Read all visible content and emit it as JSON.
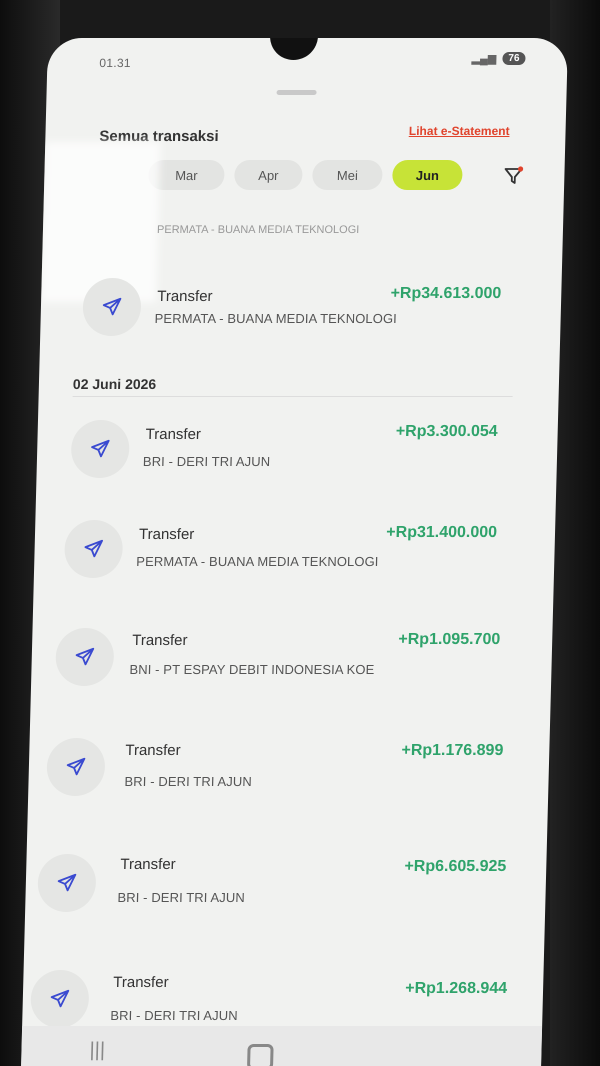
{
  "status": {
    "time": "01.31",
    "battery": "76"
  },
  "header": {
    "title": "Semua transaksi",
    "estatement_link": "Lihat e-Statement"
  },
  "months": [
    {
      "label": "Mar",
      "active": false
    },
    {
      "label": "Apr",
      "active": false
    },
    {
      "label": "Mei",
      "active": false
    },
    {
      "label": "Jun",
      "active": true
    }
  ],
  "partial_row": {
    "subtitle": "PERMATA - BUANA MEDIA TEKNOLOGI"
  },
  "date_group": {
    "label": "02 Juni 2026"
  },
  "transactions": [
    {
      "title": "Transfer",
      "subtitle": "PERMATA - BUANA MEDIA TEKNOLOGI",
      "amount": "+Rp34.613.000"
    },
    {
      "title": "Transfer",
      "subtitle": "BRI - DERI TRI AJUN",
      "amount": "+Rp3.300.054"
    },
    {
      "title": "Transfer",
      "subtitle": "PERMATA - BUANA MEDIA TEKNOLOGI",
      "amount": "+Rp31.400.000"
    },
    {
      "title": "Transfer",
      "subtitle": "BNI - PT ESPAY DEBIT INDONESIA KOE",
      "amount": "+Rp1.095.700"
    },
    {
      "title": "Transfer",
      "subtitle": "BRI - DERI TRI AJUN",
      "amount": "+Rp1.176.899"
    },
    {
      "title": "Transfer",
      "subtitle": "BRI - DERI TRI AJUN",
      "amount": "+Rp6.605.925"
    },
    {
      "title": "Transfer",
      "subtitle": "BRI - DERI TRI AJUN",
      "amount": "+Rp1.268.944"
    }
  ],
  "colors": {
    "accent_chip": "#c7e337",
    "amount_green": "#2fa36b",
    "link_red": "#e0442d"
  },
  "icons": {
    "transaction": "send-icon",
    "filter": "filter-icon"
  }
}
